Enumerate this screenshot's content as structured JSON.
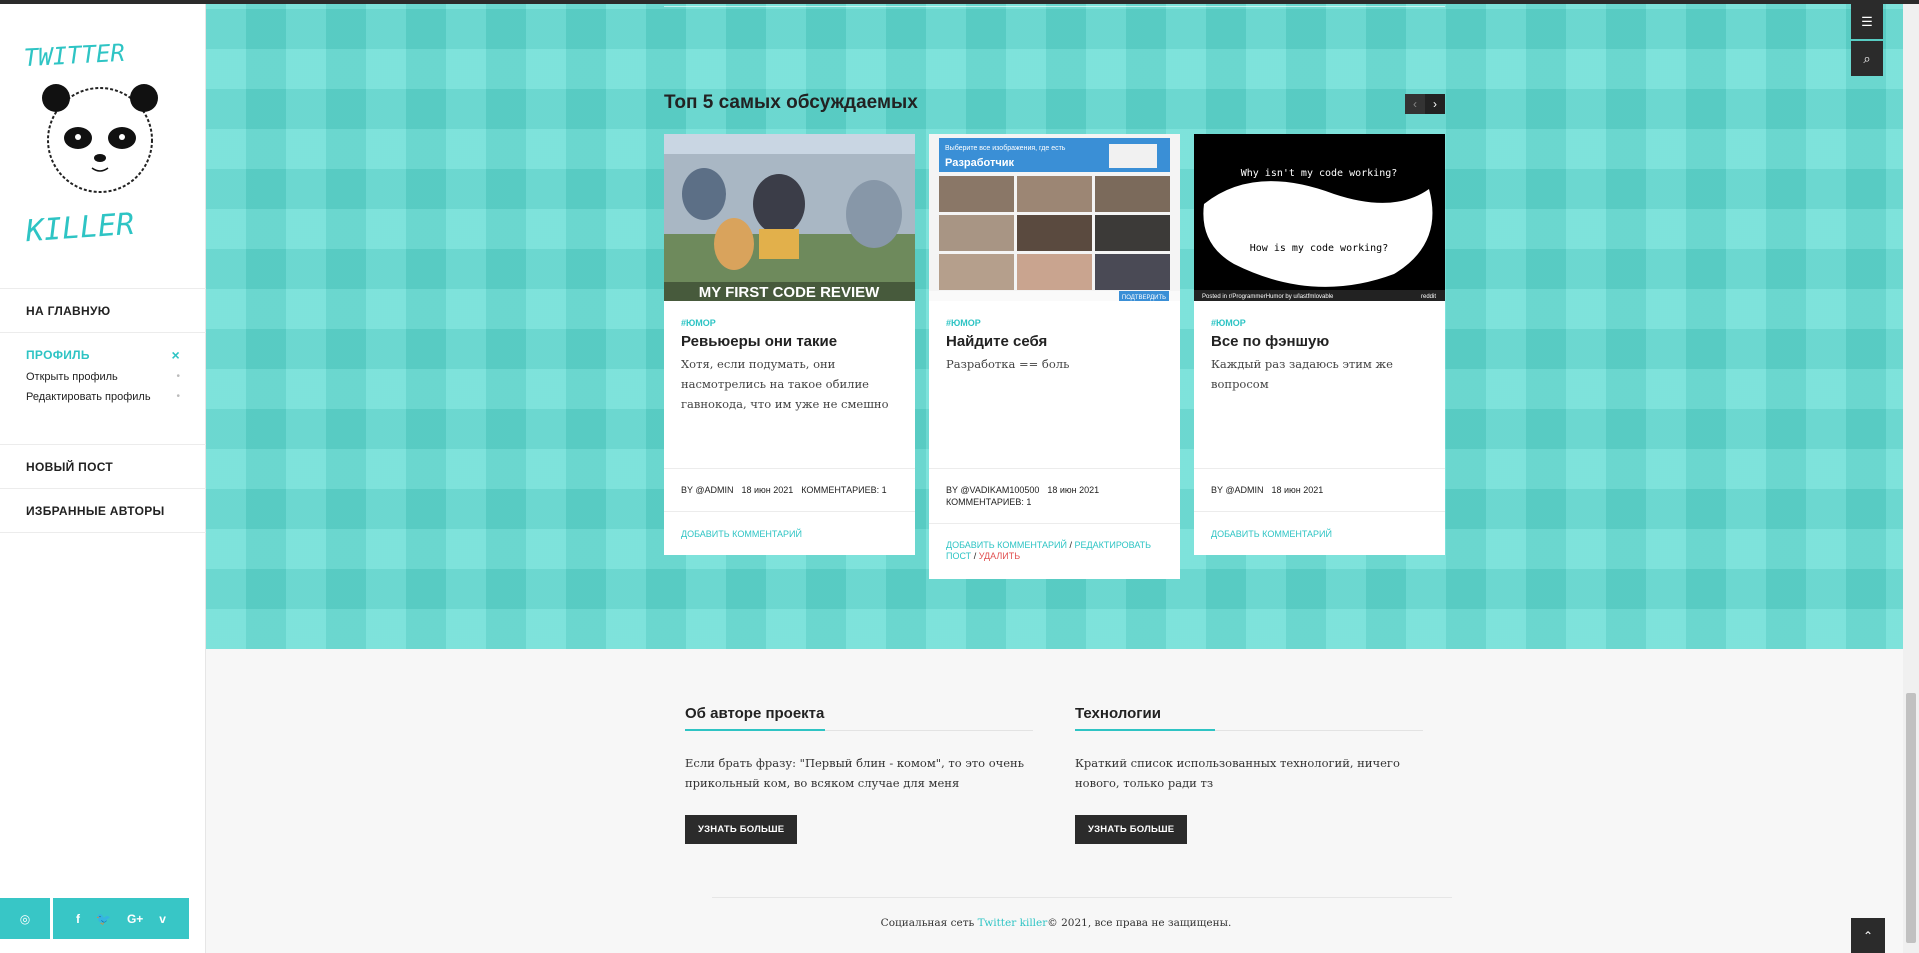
{
  "sidebar": {
    "logo_text_top": "TWITTER",
    "logo_text_bottom": "KILLER",
    "nav": {
      "home": "НА ГЛАВНУЮ",
      "profile": "ПРОФИЛЬ",
      "profile_close": "×",
      "profile_open": "Открыть профиль",
      "profile_edit": "Редактировать профиль",
      "new_post": "НОВЫЙ ПОСТ",
      "favorite_authors": "ИЗБРАННЫЕ АВТОРЫ"
    },
    "social": {
      "instagram": "◎",
      "facebook": "f",
      "twitter": "🐦",
      "google": "G+",
      "vimeo": "v"
    }
  },
  "section": {
    "title": "Топ 5 самых обсуждаемых",
    "prev": "‹",
    "next": "›"
  },
  "cards": [
    {
      "tag": "#ЮМОР",
      "title": "Ревьюеры они такие",
      "text": "Хотя, если подумать, они насмотрелись на такое обилие гавнокода, что им уже не смешно",
      "image_caption": "MY FIRST CODE REVIEW",
      "author": "BY @ADMIN",
      "date": "18 июн 2021",
      "comments": "КОММЕНТАРИЕВ: 1",
      "action": "ДОБАВИТЬ КОММЕНТАРИЙ"
    },
    {
      "tag": "#ЮМОР",
      "title": "Найдите себя",
      "text": "Разработка == боль",
      "image_caption": "Разработчик",
      "image_caption_top": "Выберите все изображения, где есть",
      "image_button": "ПОДТВЕРДИТЬ",
      "author": "BY @VADIKAM100500",
      "date": "18 июн 2021",
      "comments": "КОММЕНТАРИЕВ: 1",
      "action": "ДОБАВИТЬ КОММЕНТАРИЙ",
      "sep": "/",
      "edit": "РЕДАКТИРОВАТЬ ПОСТ",
      "delete": "УДАЛИТЬ"
    },
    {
      "tag": "#ЮМОР",
      "title": "Все по фэншую",
      "text": "Каждый раз задаюсь этим же вопросом",
      "image_top": "Why isn't my code working?",
      "image_bottom": "How is my code working?",
      "image_footer": "Posted in r/ProgrammerHumor by u/lastfmlovable",
      "image_footer_right": "reddit",
      "author": "BY @ADMIN",
      "date": "18 июн 2021",
      "action": "ДОБАВИТЬ КОММЕНТАРИЙ"
    }
  ],
  "footer": {
    "about_title": "Об авторе проекта",
    "about_text": "Если брать фразу: \"Первый блин - комом\", то это очень прикольный ком, во всяком случае для меня",
    "about_button": "УЗНАТЬ БОЛЬШЕ",
    "tech_title": "Технологии",
    "tech_text": "Краткий список использованных технологий, ничего нового, только ради тз",
    "tech_button": "УЗНАТЬ БОЛЬШЕ",
    "copyright_pre": "Социальная сеть ",
    "copyright_link": "Twitter killer",
    "copyright_post": "© 2021, все права не защищены."
  },
  "controls": {
    "menu": "☰",
    "search": "⌕",
    "to_top": "⌃"
  },
  "colors": {
    "accent": "#2ec4c4",
    "hero": "#5fdcd3",
    "dark": "#2b2b2b"
  }
}
